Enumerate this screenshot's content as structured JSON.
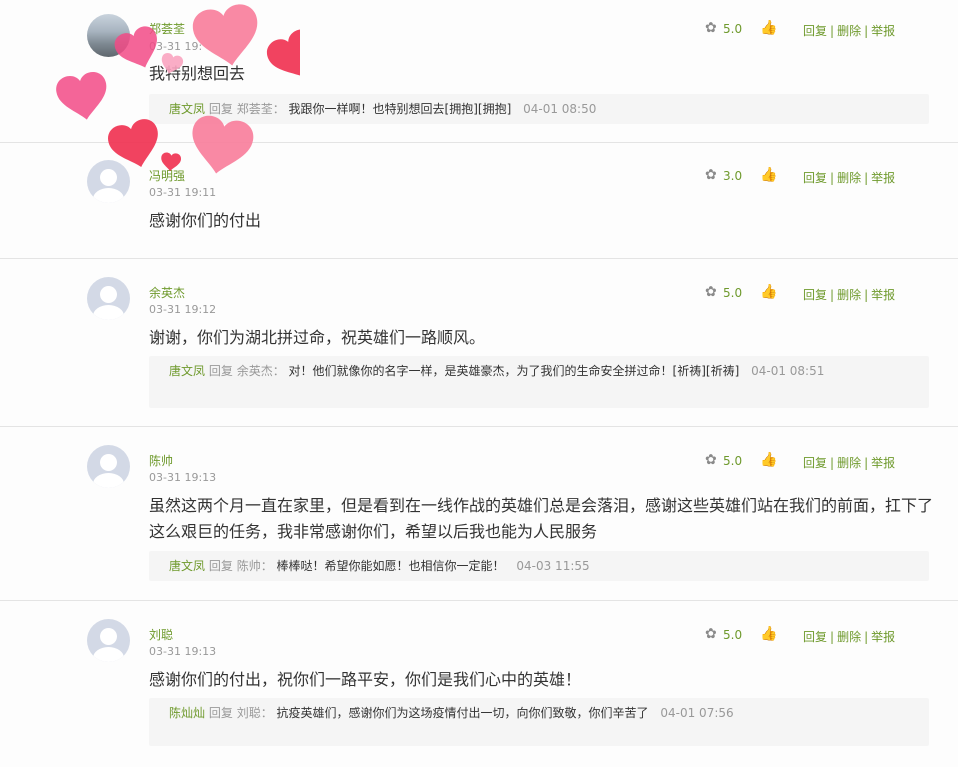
{
  "labels": {
    "reply": "回复",
    "delete": "删除",
    "report": "举报",
    "reply_word": "回复"
  },
  "colors": {
    "accent": "#6f9a2d",
    "heart": "#f2406a",
    "heart_light": "#f87c9a"
  },
  "icons": {
    "rose": "rose-icon",
    "like": "thumbs-up-icon",
    "hearts": "heart-sticker-icons"
  },
  "comments": [
    {
      "user": "郑荟荃",
      "time": "03-31 19:",
      "text": "我特别想回去",
      "score": "5.0",
      "reply": {
        "name": "唐文凤",
        "target": "郑荟荃：",
        "text": "我跟你一样啊！也特别想回去[拥抱][拥抱]",
        "time": "04-01 08:50"
      }
    },
    {
      "user": "冯明强",
      "time": "03-31 19:11",
      "text": "感谢你们的付出",
      "score": "3.0"
    },
    {
      "user": "余英杰",
      "time": "03-31 19:12",
      "text": "谢谢，你们为湖北拼过命，祝英雄们一路顺风。",
      "score": "5.0",
      "reply": {
        "name": "唐文凤",
        "target": "余英杰：",
        "text": "对！他们就像你的名字一样，是英雄豪杰，为了我们的生命安全拼过命！[祈祷][祈祷]",
        "time": "04-01 08:51"
      }
    },
    {
      "user": "陈帅",
      "time": "03-31 19:13",
      "text": "虽然这两个月一直在家里，但是看到在一线作战的英雄们总是会落泪，感谢这些英雄们站在我们的前面，扛下了这么艰巨的任务，我非常感谢你们，希望以后我也能为人民服务",
      "score": "5.0",
      "reply": {
        "name": "唐文凤",
        "target": "陈帅：",
        "text": "棒棒哒！希望你能如愿！也相信你一定能！",
        "time": "04-03 11:55"
      }
    },
    {
      "user": "刘聪",
      "time": "03-31 19:13",
      "text": "感谢你们的付出，祝你们一路平安，你们是我们心中的英雄！",
      "score": "5.0",
      "reply": {
        "name": "陈灿灿",
        "target": "刘聪：",
        "text": "抗疫英雄们，感谢你们为这场疫情付出一切，向你们致敬，你们辛苦了",
        "time": "04-01 07:56"
      }
    }
  ]
}
